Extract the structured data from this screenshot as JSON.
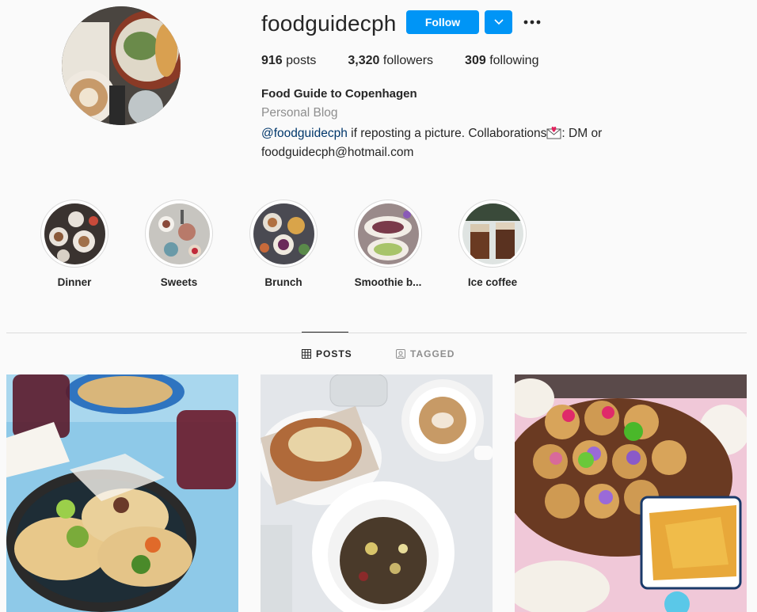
{
  "profile": {
    "username": "foodguidecph",
    "follow_label": "Follow",
    "stats": {
      "posts": "916",
      "posts_label": "posts",
      "followers": "3,320",
      "followers_label": "followers",
      "following": "309",
      "following_label": "following"
    },
    "full_name": "Food Guide to Copenhagen",
    "category": "Personal Blog",
    "bio": {
      "mention": "@foodguidecph",
      "text1": " if reposting a picture. Collaborations",
      "text2": ": DM or",
      "line2": "foodguidecph@hotmail.com"
    }
  },
  "highlights": [
    {
      "label": "Dinner"
    },
    {
      "label": "Sweets"
    },
    {
      "label": "Brunch"
    },
    {
      "label": "Smoothie b..."
    },
    {
      "label": "Ice coffee"
    }
  ],
  "tabs": {
    "posts": "POSTS",
    "tagged": "TAGGED"
  },
  "colors": {
    "accent": "#0095f6",
    "mention": "#00376b",
    "muted": "#8e8e8e"
  },
  "icons": [
    "chevron-down-icon",
    "more-options-icon",
    "grid-icon",
    "tagged-icon",
    "envelope-heart-icon"
  ]
}
